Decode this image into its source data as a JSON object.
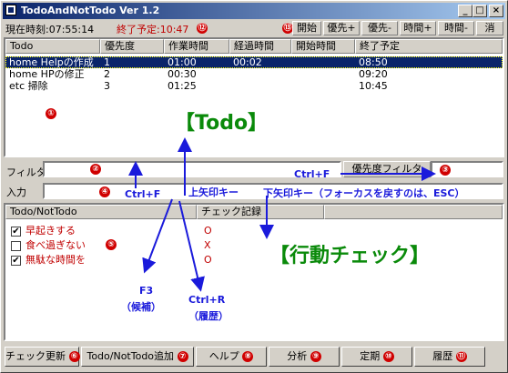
{
  "window": {
    "title": "TodoAndNotTodo Ver 1.2",
    "min_label": "_",
    "max_label": "□",
    "close_label": "×"
  },
  "status": {
    "current_time": "現在時刻:07:55:14",
    "end_forecast": "終了予定:10:47"
  },
  "toolbar": {
    "start": "開始",
    "prio_up": "優先+",
    "prio_down": "優先-",
    "time_up": "時間+",
    "time_down": "時間-",
    "delete": "消"
  },
  "todo_list": {
    "headers": [
      "Todo",
      "優先度",
      "作業時間",
      "経過時間",
      "開始時間",
      "終了予定"
    ],
    "rows": [
      [
        "home Helpの作成",
        "1",
        "01:00",
        "00:02",
        "",
        "08:50"
      ],
      [
        "home HPの修正",
        "2",
        "00:30",
        "",
        "",
        "09:20"
      ],
      [
        "etc 掃除",
        "3",
        "01:25",
        "",
        "",
        "10:45"
      ]
    ],
    "selected_row": 0
  },
  "filter": {
    "label": "フィルタ",
    "value": "",
    "priority_filter_button": "優先度フィルタ",
    "priority_value": ""
  },
  "input": {
    "label": "入力",
    "value": ""
  },
  "check_list": {
    "headers": [
      "Todo/NotTodo",
      "チェック記録"
    ],
    "rows": [
      {
        "label": "早起きする",
        "checked": true,
        "record": "O"
      },
      {
        "label": "食べ過ぎない",
        "checked": false,
        "record": "X"
      },
      {
        "label": "無駄な時間を",
        "checked": true,
        "record": "O"
      }
    ]
  },
  "buttons": {
    "check_update": "チェック更新",
    "add_todo": "Todo/NotTodo追加",
    "help": "ヘルプ",
    "analyze": "分析",
    "periodic": "定期",
    "history": "履歴"
  },
  "annotations": {
    "todo_title": "【Todo】",
    "action_check_title": "【行動チェック】",
    "ctrl_f_1": "Ctrl+F",
    "ctrl_f_2": "Ctrl+F",
    "up_key": "上矢印キー",
    "down_key": "下矢印キー（フォーカスを戻すのは、ESC）",
    "f3": "F3",
    "f3_sub": "（候補）",
    "ctrl_r": "Ctrl+R",
    "ctrl_r_sub": "（履歴）"
  },
  "numbers": [
    "①",
    "②",
    "③",
    "④",
    "⑤",
    "⑥",
    "⑦",
    "⑧",
    "⑨",
    "⑩",
    "⑪",
    "⑫",
    "⑬"
  ],
  "colors": {
    "title_bar": "#0a246a",
    "selection": "#0a246a",
    "annotation_blue": "#1a1adb",
    "annotation_green": "#0a8a0a",
    "marker_red": "#d00000",
    "warning_red": "#c00000"
  }
}
